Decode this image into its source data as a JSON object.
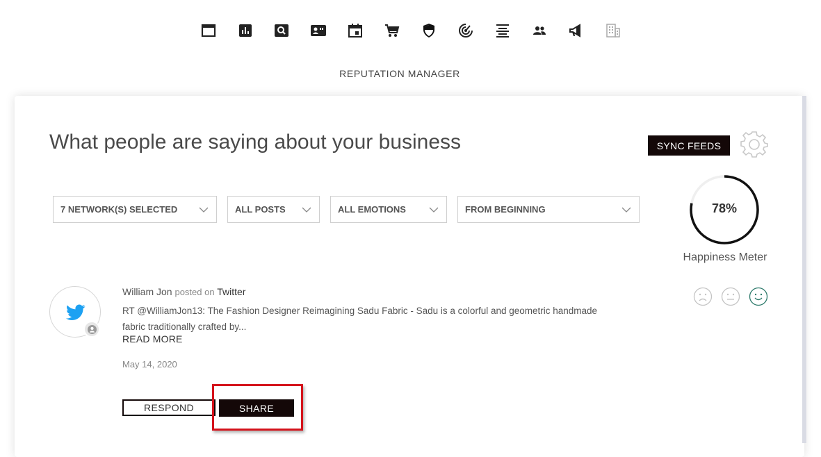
{
  "app": {
    "section_title": "REPUTATION MANAGER"
  },
  "topnav": {
    "icons": [
      {
        "name": "window-icon"
      },
      {
        "name": "bar-chart-icon"
      },
      {
        "name": "search-icon"
      },
      {
        "name": "contact-card-icon"
      },
      {
        "name": "calendar-icon"
      },
      {
        "name": "shopping-cart-icon"
      },
      {
        "name": "shield-icon"
      },
      {
        "name": "radar-icon"
      },
      {
        "name": "align-center-icon"
      },
      {
        "name": "people-icon"
      },
      {
        "name": "megaphone-icon"
      },
      {
        "name": "building-icon"
      }
    ]
  },
  "main": {
    "heading": "What people are saying about your business",
    "sync_label": "SYNC FEEDS",
    "settings_icon": "gear-icon"
  },
  "filters": {
    "networks": "7 NETWORK(S) SELECTED",
    "posts": "ALL POSTS",
    "emotions": "ALL EMOTIONS",
    "period": "FROM BEGINNING"
  },
  "happiness": {
    "value": "78%",
    "fraction": 0.78,
    "label": "Happiness Meter"
  },
  "post": {
    "author": "William Jon",
    "posted_on": "posted on",
    "network": "Twitter",
    "text_line1": "RT @WilliamJon13: The Fashion Designer Reimagining Sadu Fabric - Sadu is a colorful and geometric handmade",
    "text_line2": "fabric traditionally crafted by...",
    "read_more": "READ MORE",
    "date": "May 14, 2020",
    "respond_label": "RESPOND",
    "share_label": "SHARE",
    "selected_emotion": "happy"
  },
  "colors": {
    "primary_button": "#140808",
    "twitter_blue": "#1da1f2",
    "highlight": "#d4121b",
    "happy_face": "#2d7a6b",
    "neutral_face": "#bdbdbd"
  }
}
